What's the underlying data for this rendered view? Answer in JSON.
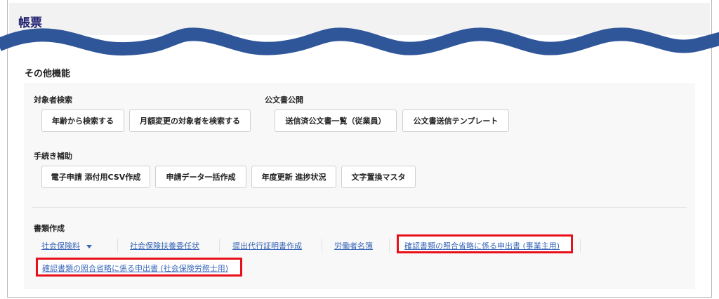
{
  "header": {
    "title": "帳票"
  },
  "section_title": "その他機能",
  "groups": {
    "search": {
      "label": "対象者検索",
      "buttons": [
        "年齢から検索する",
        "月額変更の対象者を検索する"
      ]
    },
    "public_docs": {
      "label": "公文書公開",
      "buttons": [
        "送信済公文書一覧（従業員）",
        "公文書送信テンプレート"
      ]
    },
    "procedure": {
      "label": "手続き補助",
      "buttons": [
        "電子申請 添付用CSV作成",
        "申請データ一括作成",
        "年度更新 進捗状況",
        "文字置換マスタ"
      ]
    },
    "documents": {
      "label": "書類作成",
      "links": [
        "社会保険料",
        "社会保険扶養委任状",
        "提出代行証明書作成",
        "労働者名簿",
        "確認書類の照合省略に係る申出書 (事業主用)",
        "確認書類の照合省略に係る申出書 (社会保険労務士用)"
      ]
    }
  },
  "colors": {
    "wave": "#30569a",
    "highlight": "#e8101a",
    "link": "#3b68b8"
  }
}
